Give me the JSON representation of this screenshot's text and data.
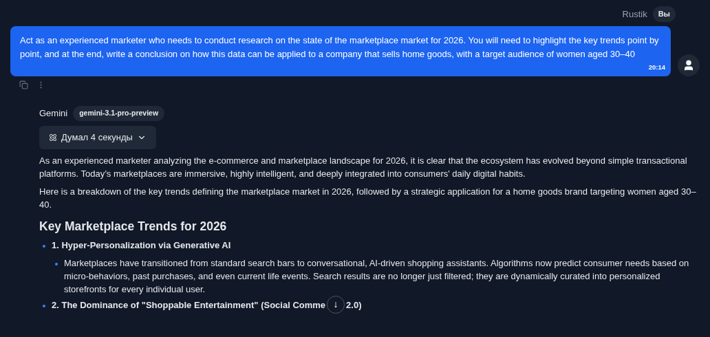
{
  "user_message": {
    "author": "Rustik",
    "badge": "Вы",
    "text": "Act as an experienced marketer who needs to conduct research on the state of the marketplace market for 2026. You will need to highlight the key trends point by point, and at the end, write a conclusion on how this data can be applied to a company that sells home goods, with a target audience of women aged 30–40",
    "time": "20:14"
  },
  "reply": {
    "author": "Gemini",
    "model": "gemini-3.1-pro-preview",
    "thinking": {
      "label": "Думал 4 секунды",
      "expanded": false
    },
    "paragraphs": [
      "As an experienced marketer analyzing the e-commerce and marketplace landscape for 2026, it is clear that the ecosystem has evolved beyond simple transactional platforms. Today’s marketplaces are immersive, highly intelligent, and deeply integrated into consumers' daily digital habits.",
      "Here is a breakdown of the key trends defining the marketplace market in 2026, followed by a strategic application for a home goods brand targeting women aged 30–40."
    ],
    "heading": "Key Marketplace Trends for 2026",
    "trends": [
      {
        "title": "1. Hyper-Personalization via Generative AI",
        "points": [
          "Marketplaces have transitioned from standard search bars to conversational, AI-driven shopping assistants. Algorithms now predict consumer needs based on micro-behaviors, past purchases, and even current life events. Search results are no longer just filtered; they are dynamically curated into personalized storefronts for every individual user."
        ]
      },
      {
        "title": "2. The Dominance of \"Shoppable Entertainment\" (Social Comme",
        "title_after_button": "2.0)"
      }
    ]
  },
  "scroll_button": {
    "label": "↓"
  }
}
